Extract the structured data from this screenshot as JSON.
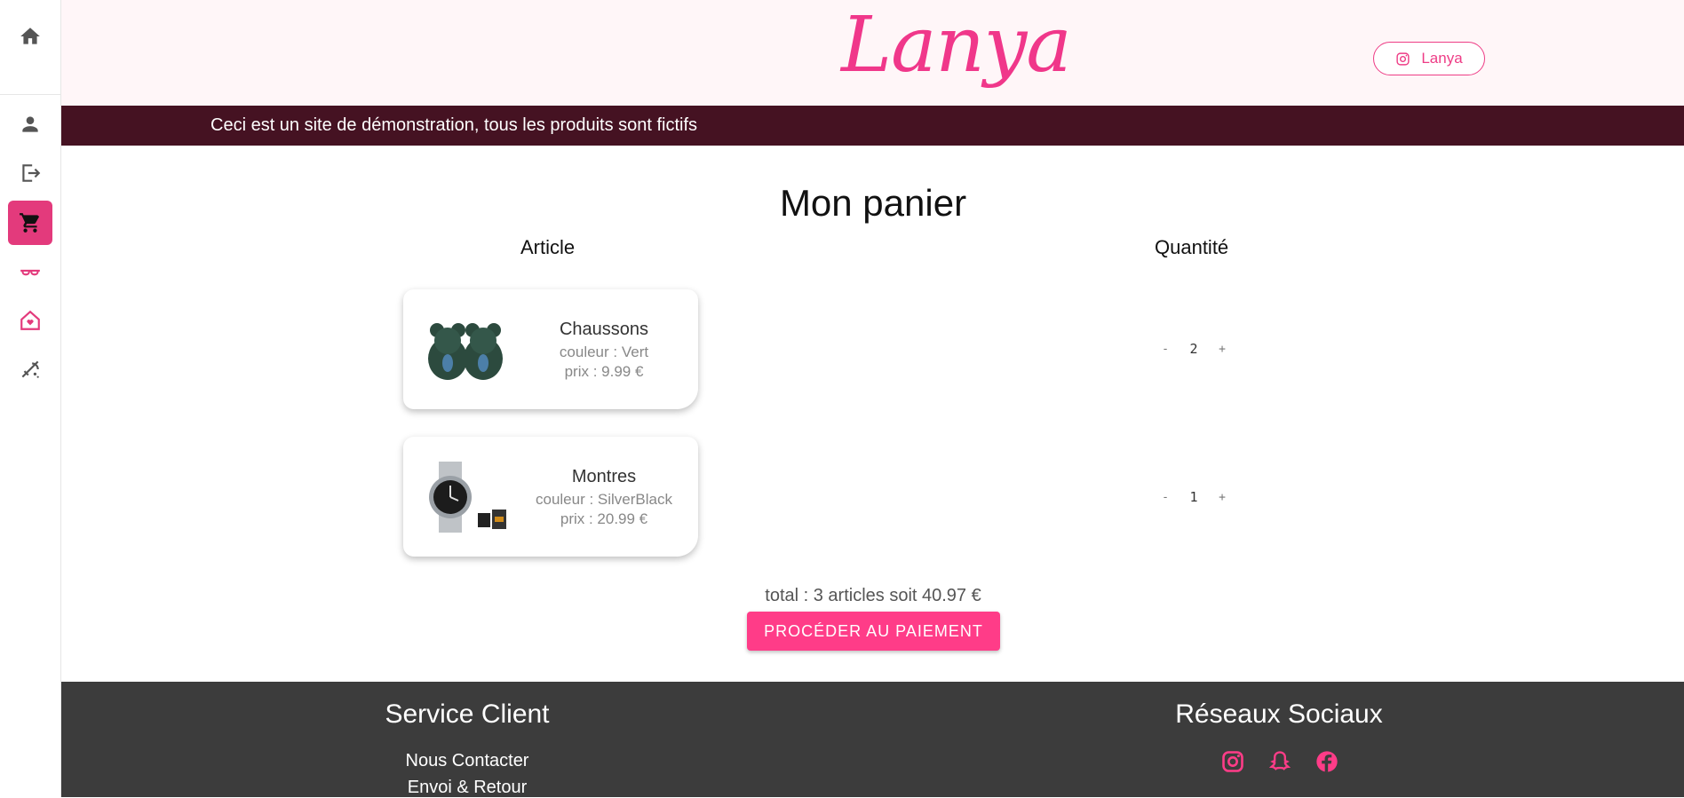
{
  "sidebar": {
    "items": [
      {
        "icon": "home-icon"
      },
      {
        "icon": "user-icon"
      },
      {
        "icon": "logout-icon"
      },
      {
        "icon": "cart-icon",
        "active": true
      },
      {
        "icon": "glasses-icon"
      },
      {
        "icon": "house-heart-icon"
      },
      {
        "icon": "makeup-icon"
      }
    ]
  },
  "header": {
    "logo": "Lanya",
    "instagram_label": "Lanya"
  },
  "banner": {
    "text": "Ceci est un site de démonstration, tous les produits sont fictifs"
  },
  "cart": {
    "title": "Mon panier",
    "col_article": "Article",
    "col_quantity": "Quantité",
    "items": [
      {
        "name": "Chaussons",
        "color": "couleur : Vert",
        "price": "prix : 9.99 €",
        "minus": "-",
        "qty": "2",
        "plus": "+"
      },
      {
        "name": "Montres",
        "color": "couleur : SilverBlack",
        "price": "prix : 20.99 €",
        "minus": "-",
        "qty": "1",
        "plus": "+"
      }
    ],
    "total": "total : 3 articles soit 40.97 €",
    "pay_button": "PROCÉDER AU PAIEMENT"
  },
  "footer": {
    "service_title": "Service Client",
    "links": [
      "Nous Contacter",
      "Envoi & Retour"
    ],
    "social_title": "Réseaux Sociaux",
    "social_icons": [
      "instagram-icon",
      "snapchat-icon",
      "facebook-icon"
    ]
  },
  "colors": {
    "accent": "#ff3c88",
    "banner": "#451222",
    "footer": "#3c3c3c"
  }
}
